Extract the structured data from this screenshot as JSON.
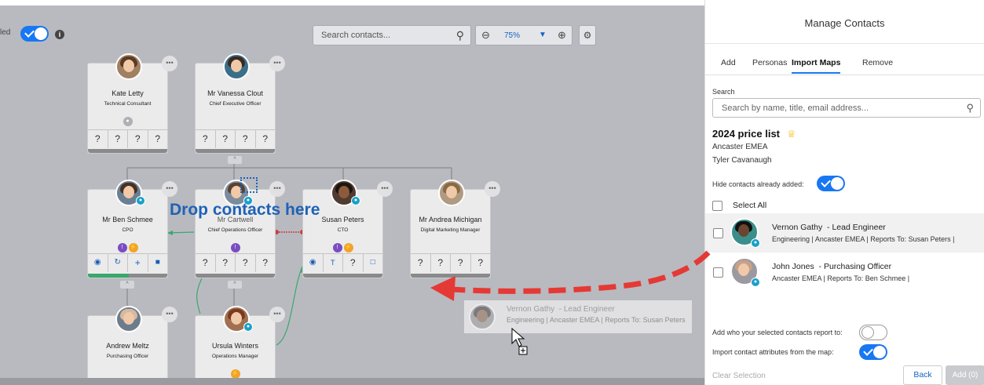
{
  "canvas": {
    "toggle_label_fragment": "led",
    "search_placeholder": "Search contacts...",
    "zoom_value": "75%",
    "drop_hint": "Drop contacts here"
  },
  "cards": [
    {
      "name": "Kate Letty",
      "title": "Technical Consultant",
      "q": [
        "?",
        "?",
        "?",
        "?"
      ]
    },
    {
      "name": "Mr Vanessa Clout",
      "title": "Chief Executive Officer",
      "q": [
        "?",
        "?",
        "?",
        "?"
      ]
    },
    {
      "name": "Mr Ben Schmee",
      "title": "CPO",
      "q": [
        "◉",
        "↻",
        "+",
        "■"
      ]
    },
    {
      "name": "Mr Cartwell",
      "title": "Chief Operations Officer",
      "q": [
        "?",
        "?",
        "?",
        "?"
      ]
    },
    {
      "name": "Susan Peters",
      "title": "CTO",
      "q": [
        "◉",
        "T",
        "?",
        "□"
      ]
    },
    {
      "name": "Mr Andrea Michigan",
      "title": "Digital Marketing Manager",
      "q": [
        "?",
        "?",
        "?",
        "?"
      ]
    },
    {
      "name": "Andrew Meltz",
      "title": "Purchasing Officer"
    },
    {
      "name": "Ursula Winters",
      "title": "Operations Manager"
    }
  ],
  "ghost": {
    "name": "Vernon Gathy",
    "role": "Lead Engineer",
    "sub": "Engineering | Ancaster EMEA | Reports To: Susan Peters"
  },
  "panel": {
    "title": "Manage Contacts",
    "tabs": [
      "Add",
      "Personas",
      "Import Maps",
      "Remove"
    ],
    "active_tab": "Import Maps",
    "search_label": "Search",
    "search_placeholder": "Search by name, title, email address...",
    "map_name": "2024 price list",
    "map_line1": "Ancaster EMEA",
    "map_line2": "Tyler Cavanaugh",
    "hide_label": "Hide contacts already added:",
    "select_all": "Select All",
    "contacts": [
      {
        "name": "Vernon Gathy",
        "role": "Lead Engineer",
        "sub": "Engineering | Ancaster EMEA | Reports To: Susan Peters |"
      },
      {
        "name": "John Jones",
        "role": "Purchasing Officer",
        "sub": "Ancaster EMEA | Reports To: Ben Schmee |"
      }
    ],
    "report_label": "Add who your selected contacts report to:",
    "report_toggle": false,
    "attr_label": "Import contact attributes from the map:",
    "attr_toggle": true,
    "hide_toggle": true,
    "clear_selection": "Clear Selection",
    "back": "Back",
    "add": "Add (0)"
  },
  "colors": {
    "accent": "#1877f2",
    "drop_text": "#1e62b6",
    "arrow": "#e53935",
    "connector_green": "#3aa76d"
  },
  "icons": [
    "info-icon",
    "search-icon",
    "zoom-out-icon",
    "caret-down-icon",
    "zoom-in-icon",
    "gear-icon",
    "crown-icon",
    "more-icon",
    "drag-cursor-icon"
  ]
}
